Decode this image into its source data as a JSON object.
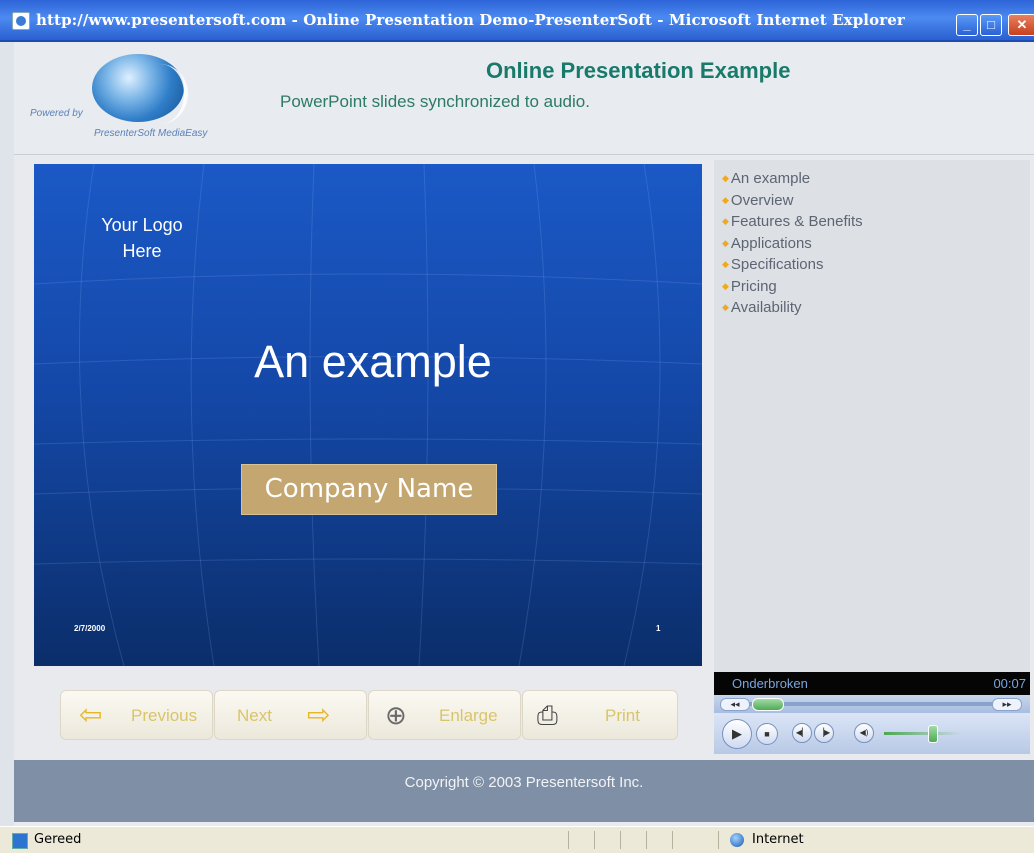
{
  "window": {
    "title": "http://www.presentersoft.com - Online Presentation Demo-PresenterSoft - Microsoft Internet Explorer",
    "buttons": {
      "minimize": "_",
      "maximize": "□",
      "close": "✕"
    }
  },
  "header": {
    "powered_by": "Powered by",
    "product": "PresenterSoft MediaEasy",
    "title": "Online Presentation Example",
    "subtitle": "PowerPoint slides synchronized to audio."
  },
  "slide": {
    "logo_line1": "Your Logo",
    "logo_line2": "Here",
    "title": "An example",
    "company": "Company Name",
    "date": "2/7/2000",
    "number": "1"
  },
  "toc": {
    "items": [
      "An example",
      "Overview",
      "Features & Benefits",
      "Applications",
      "Specifications",
      "Pricing",
      "Availability"
    ],
    "bullet": "◆",
    "bullet_color": "#f0a81c"
  },
  "nav": {
    "previous": "Previous",
    "next": "Next",
    "enlarge": "Enlarge",
    "print": "Print"
  },
  "player": {
    "status": "Onderbroken",
    "time": "00:07",
    "progress": 0.12,
    "volume": 0.65
  },
  "footer": {
    "copyright": "Copyright © 2003 Presentersoft Inc."
  },
  "statusbar": {
    "status": "Gereed",
    "zone": "Internet"
  },
  "colors": {
    "title_green": "#197a6c",
    "slide_blue": "#1448a8",
    "company_gold": "#c4a670",
    "footer_gray": "#7f90a6"
  }
}
